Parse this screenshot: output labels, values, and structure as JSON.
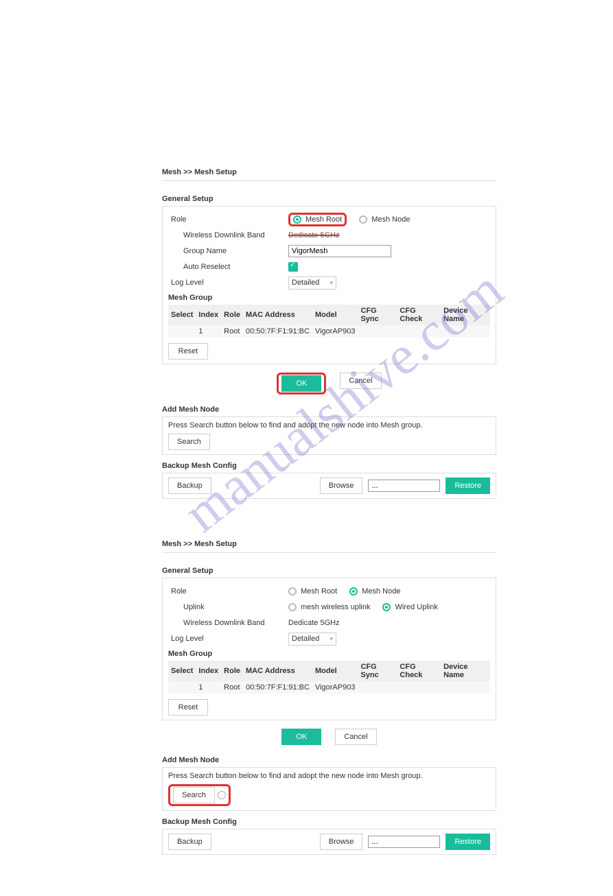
{
  "watermark": "manualshive.com",
  "panel1": {
    "breadcrumb": "Mesh >> Mesh Setup",
    "general_setup": "General Setup",
    "role_label": "Role",
    "mesh_root": "Mesh Root",
    "mesh_node": "Mesh Node",
    "wdb_label": "Wireless Downlink Band",
    "wdb_value": "Dedicate 5GHz",
    "group_name_label": "Group Name",
    "group_name_value": "VigorMesh",
    "auto_reselect": "Auto Reselect",
    "log_level_label": "Log Level",
    "log_level_value": "Detailed",
    "mesh_group": "Mesh Group",
    "th": {
      "select": "Select",
      "index": "Index",
      "role": "Role",
      "mac": "MAC Address",
      "model": "Model",
      "cfgsync": "CFG Sync",
      "cfgcheck": "CFG Check",
      "devname": "Device Name"
    },
    "row": {
      "index": "1",
      "role": "Root",
      "mac": "00:50:7F:F1:91:BC",
      "model": "VigorAP903"
    },
    "reset": "Reset",
    "ok": "OK",
    "cancel": "Cancel",
    "add_mesh_node": "Add Mesh Node",
    "add_hint": "Press Search button below to find and adopt the new node into Mesh group.",
    "search": "Search",
    "backup_head": "Backup Mesh Config",
    "backup": "Backup",
    "browse": "Browse",
    "file_value": "...",
    "restore": "Restore"
  },
  "panel2": {
    "breadcrumb": "Mesh >> Mesh Setup",
    "general_setup": "General Setup",
    "role_label": "Role",
    "mesh_root": "Mesh Root",
    "mesh_node": "Mesh Node",
    "uplink_label": "Uplink",
    "mesh_wireless_uplink": "mesh wireless uplink",
    "wired_uplink": "Wired Uplink",
    "wdb_label": "Wireless Downlink Band",
    "wdb_value": "Dedicate 5GHz",
    "log_level_label": "Log Level",
    "log_level_value": "Detailed",
    "mesh_group": "Mesh Group",
    "th": {
      "select": "Select",
      "index": "Index",
      "role": "Role",
      "mac": "MAC Address",
      "model": "Model",
      "cfgsync": "CFG Sync",
      "cfgcheck": "CFG Check",
      "devname": "Device Name"
    },
    "row": {
      "index": "1",
      "role": "Root",
      "mac": "00:50:7F:F1:91:BC",
      "model": "VigorAP903"
    },
    "reset": "Reset",
    "ok": "OK",
    "cancel": "Cancel",
    "add_mesh_node": "Add Mesh Node",
    "add_hint": "Press Search button below to find and adopt the new node into Mesh group.",
    "search": "Search",
    "backup_head": "Backup Mesh Config",
    "backup": "Backup",
    "browse": "Browse",
    "file_value": "...",
    "restore": "Restore"
  }
}
